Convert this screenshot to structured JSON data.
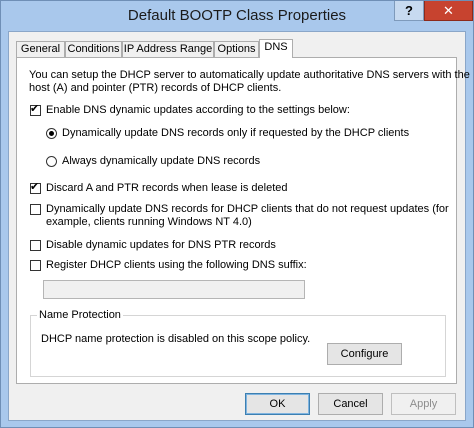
{
  "window": {
    "title": "Default BOOTP Class Properties",
    "help_label": "?",
    "close_label": "✕"
  },
  "tabs": [
    {
      "label": "General",
      "active": false
    },
    {
      "label": "Conditions",
      "active": false
    },
    {
      "label": "IP Address Range",
      "active": false
    },
    {
      "label": "Options",
      "active": false
    },
    {
      "label": "DNS",
      "active": true
    }
  ],
  "dns": {
    "intro_line1": "You can setup the DHCP server to automatically update authoritative DNS servers with the",
    "intro_line2": "host (A) and pointer (PTR) records of DHCP clients.",
    "enable_updates": {
      "label": "Enable DNS dynamic updates according to the settings below:",
      "checked": true
    },
    "radio_requested": {
      "label": "Dynamically update DNS records only if requested by the DHCP clients",
      "selected": true
    },
    "radio_always": {
      "label": "Always dynamically update DNS records",
      "selected": false
    },
    "discard_records": {
      "label": "Discard A and PTR records when lease is deleted",
      "checked": true
    },
    "update_non_requesting": {
      "line1": "Dynamically update DNS records for DHCP clients that do not request updates (for",
      "line2": "example, clients running Windows NT 4.0)",
      "checked": false
    },
    "disable_ptr": {
      "label": "Disable dynamic updates for DNS PTR records",
      "checked": false
    },
    "register_suffix": {
      "label": "Register DHCP clients using the following DNS suffix:",
      "checked": false
    },
    "suffix_value": "",
    "name_protection": {
      "title": "Name Protection",
      "status": "DHCP name protection is disabled on this scope policy.",
      "configure_label": "Configure"
    }
  },
  "footer": {
    "ok_label": "OK",
    "cancel_label": "Cancel",
    "apply_label": "Apply"
  },
  "check_mark": "✔"
}
